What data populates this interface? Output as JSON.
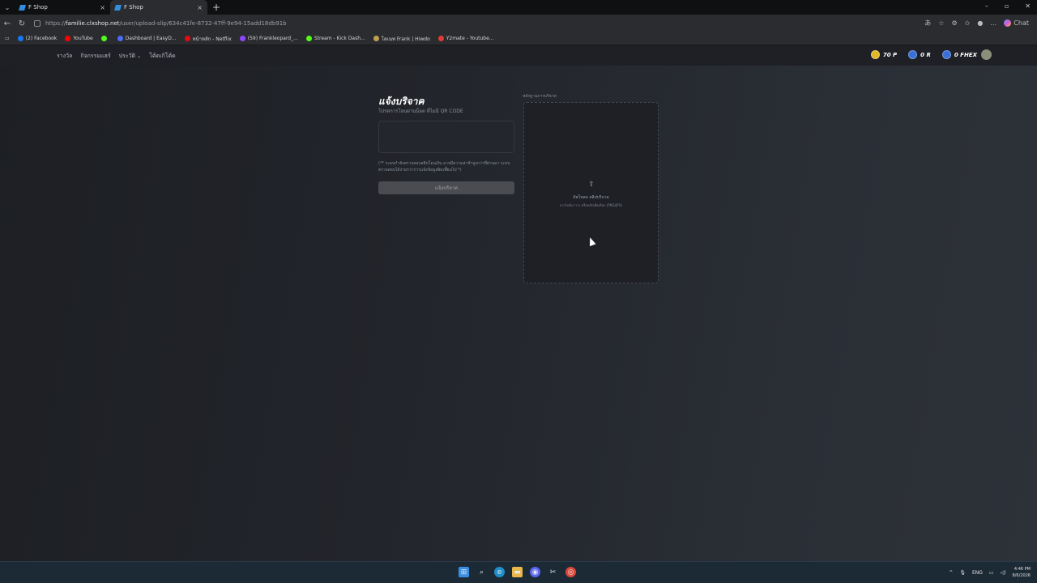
{
  "browser": {
    "tabs": [
      {
        "title": "F Shop",
        "active": false
      },
      {
        "title": "F Shop",
        "active": true
      }
    ],
    "url_prefix": "https://",
    "url_host": "familie.clxshop.net",
    "url_path": "/user/upload-slip/634c41fe-8732-47ff-9e94-15add18db91b",
    "chat_label": "Chat",
    "bookmarks": [
      {
        "label": "(2) Facebook",
        "color": "#1877f2"
      },
      {
        "label": "YouTube",
        "color": "#ff0000"
      },
      {
        "label": "",
        "color": "#53fc18"
      },
      {
        "label": "Dashboard | EasyD...",
        "color": "#4a6cf7"
      },
      {
        "label": "หน้าหลัก - Netflix",
        "color": "#e50914"
      },
      {
        "label": "(59) Frankleopard_...",
        "color": "#9146ff"
      },
      {
        "label": "Stream - Kick Dash...",
        "color": "#53fc18"
      },
      {
        "label": "โดเนท Frank | Hiwdo",
        "color": "#c0a050"
      },
      {
        "label": "Y2mate - Youtube...",
        "color": "#e53935"
      }
    ]
  },
  "site": {
    "menu": [
      "รางวัล",
      "กิจกรรมแฮร์",
      "ประวัติ",
      "โค้ดเกิโค้ด"
    ],
    "stats": [
      {
        "value": "70 P",
        "color": "#e0b82a"
      },
      {
        "value": "0 R",
        "color": "#3a6fd8"
      },
      {
        "value": "0 FHEX",
        "color": "#3a6fd8"
      }
    ]
  },
  "form": {
    "title": "แจ้งบริจาค",
    "subtitle": "โปรดการโอนผ่านน็อต ที่ไม่มี QR CODE",
    "note": "(** ระบบกำลังตรวจสอบสลิปโอนเงิน อาจมีความล่าช้าสูงกว่าที่ผ่านมา ระบบตรวจสอบได้ง่ายกว่าการแจ้งข้อมูลผิดเพี้ยนไป *)",
    "submit_label": "แจ้งบริจาค"
  },
  "upload": {
    "label": "หลักฐานการบริจาค",
    "line1": "อัพโหลด สลิปบริจาค",
    "line2": "ลากไฟล์มาวาง หรือคลิกเพื่อเลือก (PNG/JPG)"
  },
  "taskbar": {
    "lang": "ENG",
    "time": "4:46 PM",
    "date": "8/6/2026"
  }
}
